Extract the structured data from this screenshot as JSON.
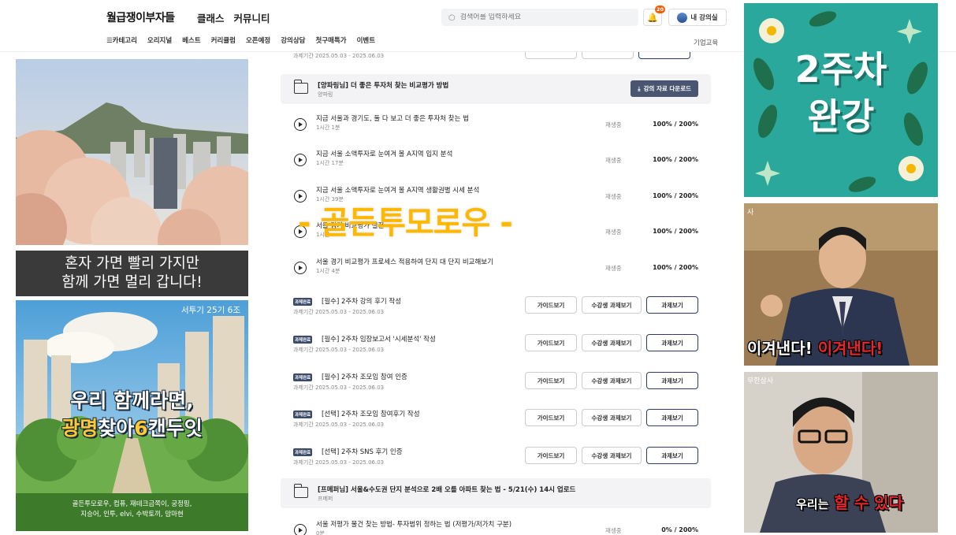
{
  "header": {
    "brand": "월급쟁이부자들",
    "top_nav": [
      "클래스",
      "커뮤니티"
    ],
    "search_placeholder": "검색어를 입력하세요",
    "notification_count": "20",
    "my_course": "내 강의실",
    "sub_nav": [
      "☰카테고리",
      "오리지널",
      "베스트",
      "커리큘럼",
      "오픈예정",
      "강의상담",
      "첫구매특가",
      "이벤트"
    ],
    "corporate": "기업교육"
  },
  "center": {
    "top_period": "과제기간 2025.05.03 - 2025.06.03",
    "section1": {
      "title": "[양파링님] 더 좋은 투자처 찾는 비교평가 방법",
      "subtitle": "양파링",
      "download_label": "강의 자료 다운로드"
    },
    "lessons": [
      {
        "title": "지금 서울과 경기도, 둘 다 보고 더 좋은 투자처 찾는 법",
        "duration": "1시간 1분",
        "status": "재생중",
        "progress": "100% / 200%"
      },
      {
        "title": "지금 서울 소액투자로 눈여겨 볼 A지역 입지 분석",
        "duration": "1시간 17분",
        "status": "재생중",
        "progress": "100% / 200%"
      },
      {
        "title": "지금 서울 소액투자로 눈여겨 볼 A지역 생활권별 시세 분석",
        "duration": "1시간 39분",
        "status": "재생중",
        "progress": "100% / 200%"
      },
      {
        "title": "서울 경기 비교평가 실전",
        "duration": "1시간",
        "status": "재생중",
        "progress": "100% / 200%"
      },
      {
        "title": "서울 경기 비교평가 프로세스 적용하여 단지 대 단지 비교해보기",
        "duration": "1시간 4분",
        "status": "재생중",
        "progress": "100% / 200%"
      }
    ],
    "task_badge": "과제완료",
    "task_buttons": {
      "guide": "가이드보기",
      "others": "수강생 과제보기",
      "view": "과제보기"
    },
    "tasks": [
      {
        "title": "[필수] 2주차 강의 후기 작성",
        "period": "과제기간 2025.05.03 - 2025.06.03"
      },
      {
        "title": "[필수] 2주차 임장보고서 '시세분석' 작성",
        "period": "과제기간 2025.05.03 - 2025.06.03"
      },
      {
        "title": "[필수] 2주차 조모임 참여 인증",
        "period": "과제기간 2025.05.03 - 2025.06.03"
      },
      {
        "title": "[선택] 2주차 조모임 참여후기 작성",
        "period": "과제기간 2025.05.03 - 2025.06.03"
      },
      {
        "title": "[선택] 2주차 SNS 후기 인증",
        "period": "과제기간 2025.05.03 - 2025.06.03"
      }
    ],
    "section2": {
      "title": "[프메퍼님] 서울&수도권 단지 분석으로 2배 오를 아파트 찾는 법 - 5/21(수) 14시 업로드",
      "subtitle": "프메퍼"
    },
    "last_lesson": {
      "title": "서울 저평가 물건 찾는 방법- 투자범위 정하는 법 (저평가/저가치 구분)",
      "duration": "0분",
      "status": "재생중",
      "progress": "0% / 200%"
    },
    "overlay": "- 골든투모로우 -"
  },
  "left": {
    "banner_line1": "혼자 가면 빨리 가지만",
    "banner_line2": "함께 가면 멀리 갑니다!",
    "poster_tag": "서투기 25기 6조",
    "poster_line1": "우리 함께라면,",
    "poster_line2_a": "광명",
    "poster_line2_b": "찾아",
    "poster_line2_c": "6",
    "poster_line2_d": "캔두잇",
    "credits_line1": "골든투모로우, 컴퓨, 재테크금쪽이, 궁정핑,",
    "credits_line2": "지승어, 인투, elvi, 수박토끼, 맘마현"
  },
  "right": {
    "sticker_line1": "2주차",
    "sticker_line2": "완강",
    "meme1_channel": "사",
    "meme1_caption_a": "이겨낸다!",
    "meme1_caption_b": "이겨낸다!",
    "meme2_channel": "무한상사",
    "meme2_caption_a": "우리는",
    "meme2_caption_b": "할 수 있다"
  },
  "colors": {
    "accent_navy": "#2c3e66",
    "badge_orange": "#f25c05",
    "overlay_yellow": "#ffb800",
    "sticker_teal": "#2aa89b"
  }
}
